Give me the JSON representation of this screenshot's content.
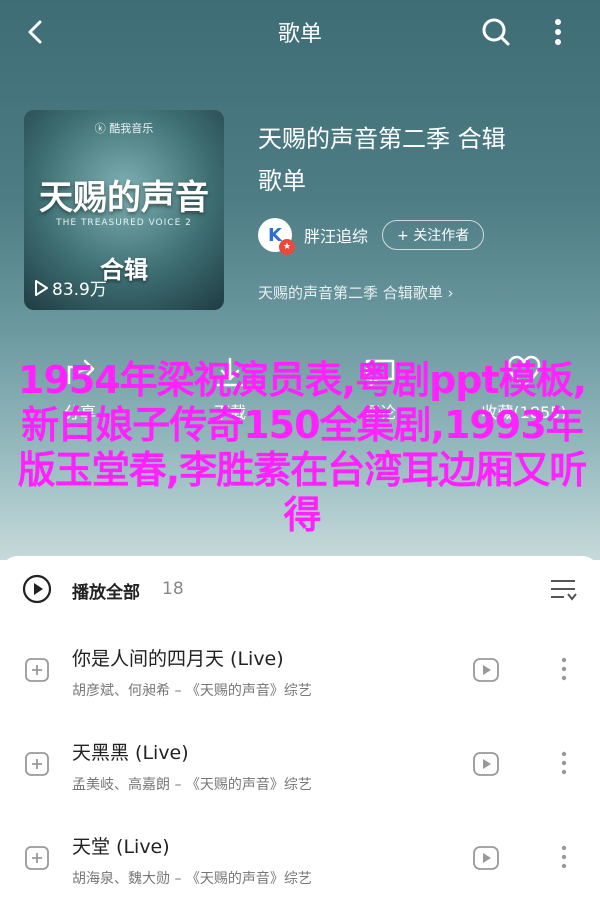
{
  "header": {
    "title": "歌单"
  },
  "playlist": {
    "title_line1": "天赐的声音第二季  合辑",
    "title_line2": "歌单",
    "creator_name": "胖汪追综",
    "follow_label": "+ 关注作者",
    "description": "天赐的声音第二季 合辑歌单 ›",
    "cover": {
      "brand": "ⓚ 酷我音乐",
      "show_name": "天赐的声音",
      "english_name": "THE TREASURED VOICE 2",
      "collection_label": "合辑",
      "play_count": "83.9万"
    }
  },
  "actions": {
    "share_label": "分享",
    "download_label": "下载",
    "comment_label": "评论",
    "favorite_label": "收藏(1855)"
  },
  "overlay_text": "1954年梁祝演员表,粤剧ppt模板,新白娘子传奇150全集剧,1993年版玉堂春,李胜素在台湾耳边厢又听得",
  "list": {
    "play_all_label": "播放全部",
    "count": "18",
    "songs": [
      {
        "title": "你是人间的四月天 (Live)",
        "meta": "胡彦斌、何昶希 – 《天赐的声音》综艺"
      },
      {
        "title": "天黑黑 (Live)",
        "meta": "孟美岐、高嘉朗 – 《天赐的声音》综艺"
      },
      {
        "title": "天堂 (Live)",
        "meta": "胡海泉、魏大勋 – 《天赐的声音》综艺"
      }
    ]
  },
  "colors": {
    "header_gradient_top": "#3f6d76",
    "overlay": "#ff22ff",
    "creator_badge": "#e84a3b"
  }
}
